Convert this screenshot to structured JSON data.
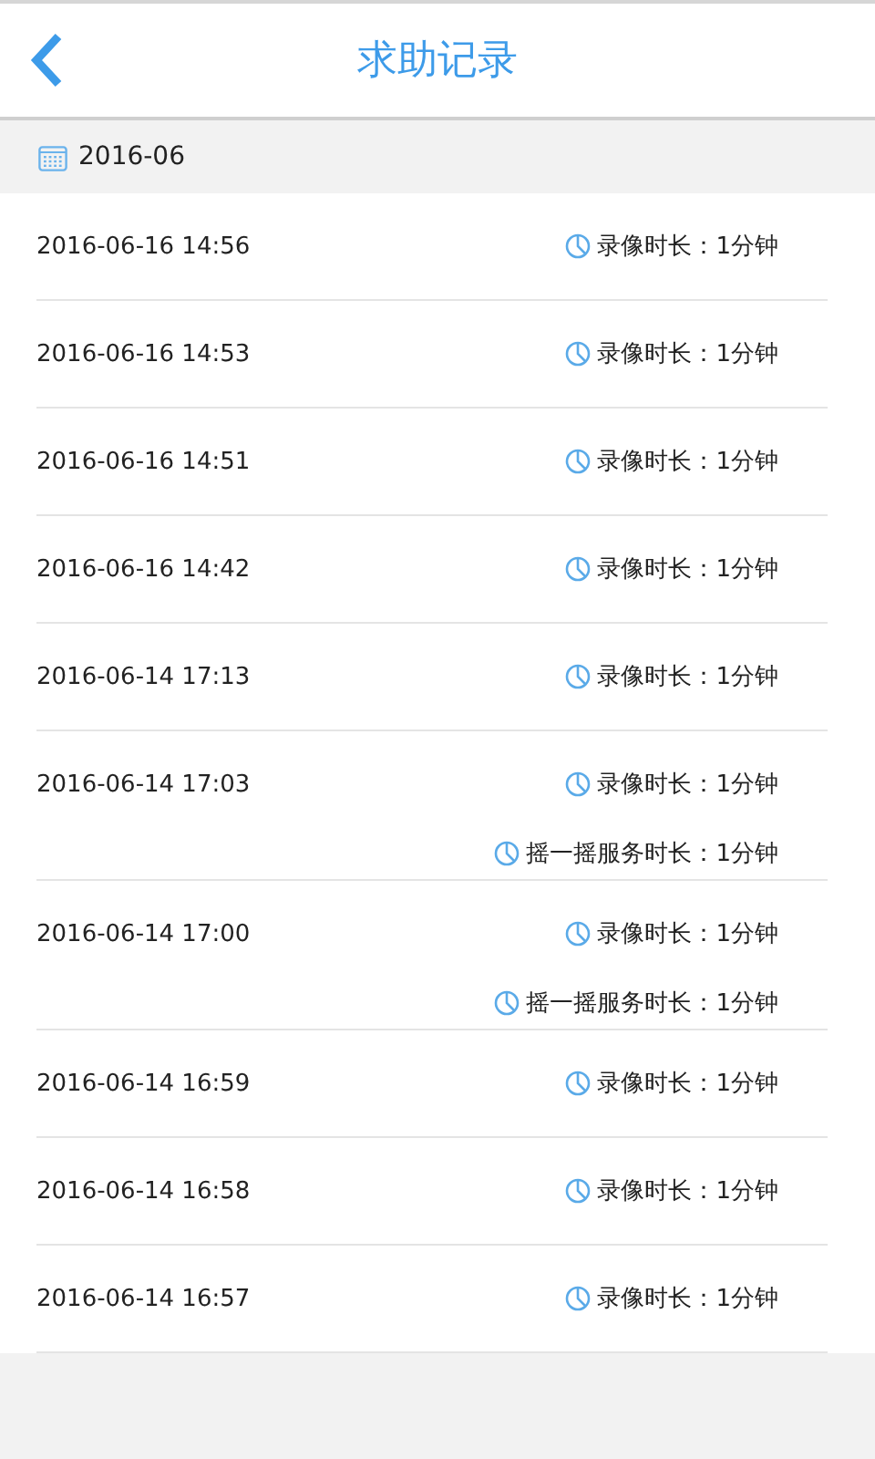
{
  "header": {
    "title": "求助记录"
  },
  "month": {
    "label": "2016-06"
  },
  "records": [
    {
      "time": "2016-06-16 14:56",
      "durations": [
        "录像时长：1分钟"
      ]
    },
    {
      "time": "2016-06-16 14:53",
      "durations": [
        "录像时长：1分钟"
      ]
    },
    {
      "time": "2016-06-16 14:51",
      "durations": [
        "录像时长：1分钟"
      ]
    },
    {
      "time": "2016-06-16 14:42",
      "durations": [
        "录像时长：1分钟"
      ]
    },
    {
      "time": "2016-06-14 17:13",
      "durations": [
        "录像时长：1分钟"
      ]
    },
    {
      "time": "2016-06-14 17:03",
      "durations": [
        "录像时长：1分钟",
        "摇一摇服务时长：1分钟"
      ]
    },
    {
      "time": "2016-06-14 17:00",
      "durations": [
        "录像时长：1分钟",
        "摇一摇服务时长：1分钟"
      ]
    },
    {
      "time": "2016-06-14 16:59",
      "durations": [
        "录像时长：1分钟"
      ]
    },
    {
      "time": "2016-06-14 16:58",
      "durations": [
        "录像时长：1分钟"
      ]
    },
    {
      "time": "2016-06-14 16:57",
      "durations": [
        "录像时长：1分钟"
      ]
    }
  ]
}
